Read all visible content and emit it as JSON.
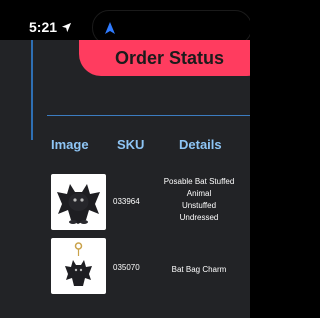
{
  "status_bar": {
    "time": "5:21"
  },
  "banner": {
    "title": "Order Status"
  },
  "table": {
    "headers": [
      "Image",
      "SKU",
      "Details"
    ],
    "rows": [
      {
        "image_alt": "black plush bat toy",
        "sku": "033964",
        "details": [
          "Posable Bat Stuffed",
          "Animal",
          "Unstuffed",
          "Undressed"
        ]
      },
      {
        "image_alt": "black bat bag charm",
        "sku": "035070",
        "details": [
          "Bat Bag Charm"
        ]
      }
    ]
  },
  "colors": {
    "banner": "#ff3c5f",
    "header_text": "#8ec5f5",
    "rule": "#2e6fb3",
    "page_bg": "#222326"
  }
}
